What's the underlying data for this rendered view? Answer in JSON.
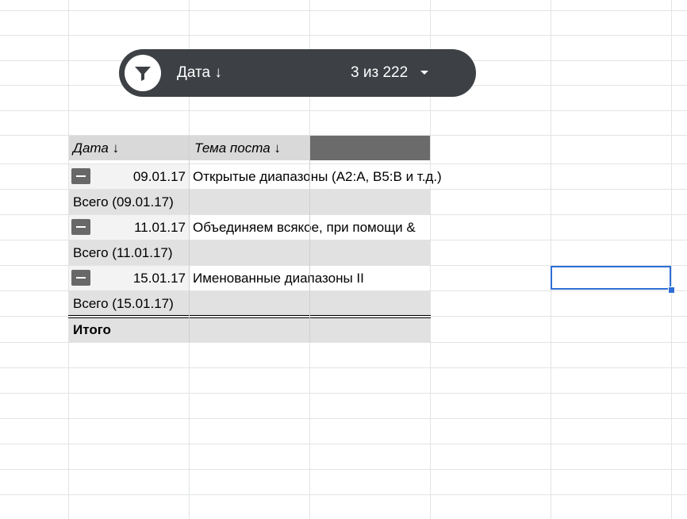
{
  "filter_bar": {
    "label": "Дата ↓",
    "count": "3 из 222",
    "icon": "filter-icon"
  },
  "pivot": {
    "headers": [
      "Дата ↓",
      "Тема поста ↓"
    ],
    "groups": [
      {
        "date": "09.01.17",
        "topic": "Открытые диапазоны  (A2:A, B5:B и т.д.)",
        "subtotal": "Всего (09.01.17)"
      },
      {
        "date": "11.01.17",
        "topic": "Объединяем всякое, при помощи &",
        "subtotal": "Всего (11.01.17)"
      },
      {
        "date": "15.01.17",
        "topic": "Именованные диапазоны II",
        "subtotal": "Всего (15.01.17)"
      }
    ],
    "grand_total": "Итого"
  },
  "colors": {
    "pill_bg": "#3d4044",
    "header_bg": "#d9d9d9",
    "header_dark": "#6b6b6b",
    "selection": "#2f6fd6"
  }
}
